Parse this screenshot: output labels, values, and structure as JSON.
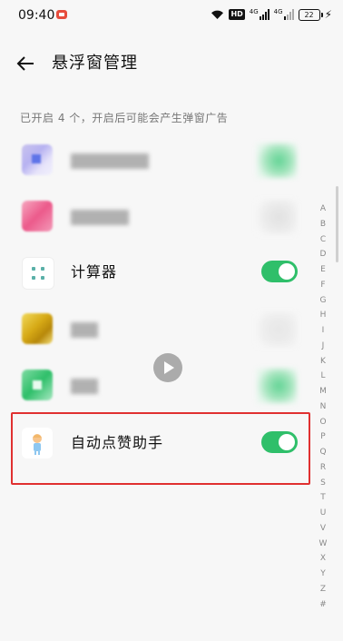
{
  "status_bar": {
    "time": "09:40",
    "hd_label": "HD",
    "signal1_label": "4G",
    "signal2_label": "4G",
    "battery": "22"
  },
  "header": {
    "title": "悬浮窗管理"
  },
  "section_label": "已开启 4 个，开启后可能会产生弹窗广告",
  "apps": [
    {
      "name": "",
      "enabled": true,
      "blurred": true
    },
    {
      "name": "",
      "enabled": true,
      "blurred": true
    },
    {
      "name": "计算器",
      "enabled": true,
      "blurred": false
    },
    {
      "name": "",
      "enabled": false,
      "blurred": true
    },
    {
      "name": "",
      "enabled": true,
      "blurred": true
    },
    {
      "name": "自动点赞助手",
      "enabled": true,
      "blurred": false
    }
  ],
  "alphabet_index": [
    "A",
    "B",
    "C",
    "D",
    "E",
    "F",
    "G",
    "H",
    "I",
    "J",
    "K",
    "L",
    "M",
    "N",
    "O",
    "P",
    "Q",
    "R",
    "S",
    "T",
    "U",
    "V",
    "W",
    "X",
    "Y",
    "Z",
    "#"
  ],
  "colors": {
    "toggle_on": "#2fbf6a",
    "highlight_border": "#e03030"
  }
}
